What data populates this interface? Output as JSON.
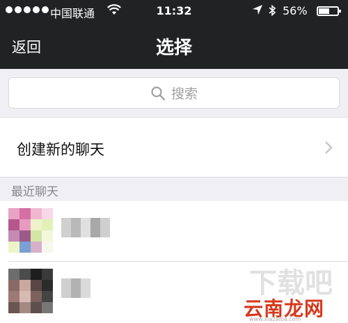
{
  "status_bar": {
    "carrier": "中国联通",
    "time": "11:32",
    "battery_percent": "56%",
    "battery_level": 0.56,
    "icons": [
      "signal-dots-icon",
      "wifi-icon",
      "location-arrow-icon",
      "bluetooth-icon",
      "battery-icon"
    ]
  },
  "nav": {
    "back_label": "返回",
    "title": "选择"
  },
  "search": {
    "placeholder": "搜索"
  },
  "new_chat": {
    "label": "创建新的聊天"
  },
  "recent": {
    "header": "最近聊天",
    "contacts": [
      {
        "avatar": "blurred",
        "name": "blurred"
      },
      {
        "avatar": "blurred",
        "name": "blurred"
      }
    ]
  },
  "watermark": {
    "brand": "云南龙网",
    "ghost": "下载吧",
    "url": "www.xiazaiba.com"
  },
  "colors": {
    "header_bg": "#202224",
    "page_bg": "#efeff4",
    "watermark_red": "#d7381c"
  }
}
